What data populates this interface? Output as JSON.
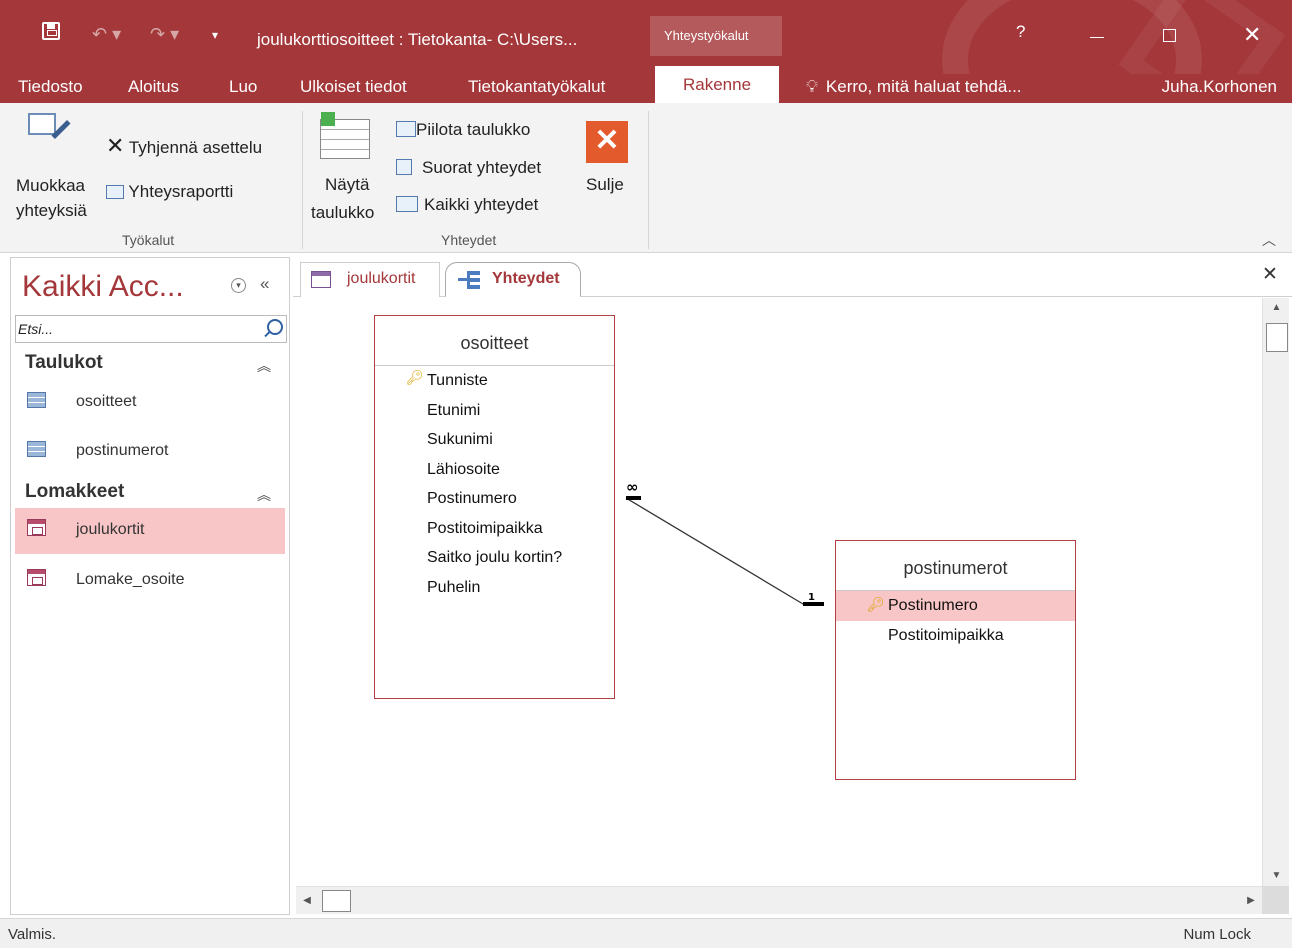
{
  "titlebar": {
    "title": "joulukorttiosoitteet : Tietokanta- C:\\Users...",
    "context_label": "Yhteystyökalut",
    "undo_icon": "undo-icon",
    "redo_icon": "redo-icon",
    "help": "?"
  },
  "ribbon_tabs": [
    "Tiedosto",
    "Aloitus",
    "Luo",
    "Ulkoiset tiedot",
    "Tietokantatyökalut",
    "Rakenne"
  ],
  "active_tab": "Rakenne",
  "search_hint": "Kerro, mitä haluat tehdä...",
  "user": "Juha.Korhonen",
  "ribbon": {
    "tools": {
      "edit_relationships_line1": "Muokkaa",
      "edit_relationships_line2": "yhteyksiä",
      "clear_layout": "Tyhjennä asettelu",
      "relationship_report": "Yhteysraportti",
      "group_label": "Työkalut"
    },
    "relationships": {
      "show_table_line1": "Näytä",
      "show_table_line2": "taulukko",
      "hide_table": "Piilota taulukko",
      "direct_relationships": "Suorat yhteydet",
      "all_relationships": "Kaikki yhteydet",
      "close": "Sulje",
      "group_label": "Yhteydet"
    }
  },
  "nav": {
    "title": "Kaikki Acc...",
    "search_placeholder": "Etsi...",
    "groups": [
      {
        "title": "Taulukot",
        "items": [
          "osoitteet",
          "postinumerot"
        ]
      },
      {
        "title": "Lomakkeet",
        "items": [
          "joulukortit",
          "Lomake_osoite"
        ]
      }
    ],
    "selected_item": "joulukortit"
  },
  "doc_tabs": [
    {
      "label": "joulukortit"
    },
    {
      "label": "Yhteydet"
    }
  ],
  "relationships": {
    "tables": [
      {
        "name": "osoitteet",
        "fields": [
          "Tunniste",
          "Etunimi",
          "Sukunimi",
          "Lähiosoite",
          "Postinumero",
          "Postitoimipaikka",
          "Saitko joulu kortin?",
          "Puhelin"
        ],
        "primary_key": "Tunniste"
      },
      {
        "name": "postinumerot",
        "fields": [
          "Postinumero",
          "Postitoimipaikka"
        ],
        "primary_key": "Postinumero"
      }
    ],
    "join": {
      "from": "osoitteet.Postinumero",
      "to": "postinumerot.Postinumero",
      "many_symbol": "∞",
      "one_symbol": "1"
    }
  },
  "status": {
    "text": "Valmis.",
    "numlock": "Num Lock"
  }
}
